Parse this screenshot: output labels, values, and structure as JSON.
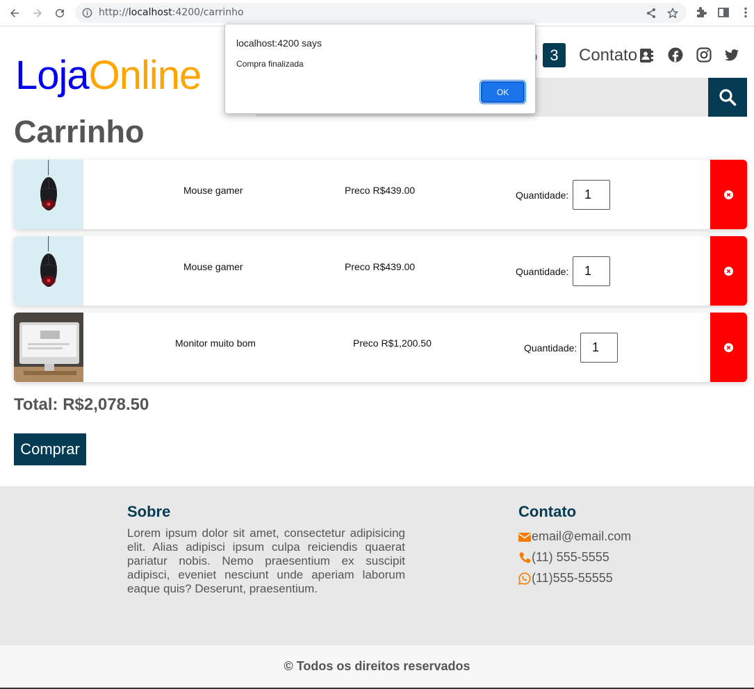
{
  "browser": {
    "url_prefix": "http://",
    "url_host": "localhost",
    "url_rest": ":4200/carrinho"
  },
  "header": {
    "logo_part1": "Loja",
    "logo_part2": "Online",
    "cart_partial": "o",
    "cart_count": "3",
    "contact_link": "Contato"
  },
  "page": {
    "title": "Carrinho",
    "items": [
      {
        "name": "Mouse gamer",
        "price": "Preco R$439.00",
        "qty_label": "Quantidade:",
        "qty": "1",
        "image": "mouse-image"
      },
      {
        "name": "Mouse gamer",
        "price": "Preco R$439.00",
        "qty_label": "Quantidade:",
        "qty": "1",
        "image": "mouse-image"
      },
      {
        "name": "Monitor muito bom",
        "price": "Preco R$1,200.50",
        "qty_label": "Quantidade:",
        "qty": "1",
        "image": "monitor-image"
      }
    ],
    "total": "Total: R$2,078.50",
    "buy_label": "Comprar"
  },
  "footer": {
    "about_title": "Sobre",
    "about_text": "Lorem ipsum dolor sit amet, consectetur adipisicing elit. Alias adipisci ipsum culpa reiciendis quaerat pariatur nobis. Nemo praesentium ex suscipit adipisci, eveniet nesciunt unde aperiam laborum eaque quis? Deserunt, praesentium.",
    "contact_title": "Contato",
    "email": "email@email.com",
    "phone": "(11) 555-5555",
    "whatsapp": "(11)555-55555",
    "copyright": "© Todos os direitos reservados"
  },
  "dialog": {
    "title": "localhost:4200 says",
    "message": "Compra finalizada",
    "ok_label": "OK"
  },
  "colors": {
    "brand_dark": "#063b54",
    "remove_red": "#ff0000",
    "logo_blue": "#0000ee",
    "logo_orange": "#ffa500",
    "contact_icon_orange": "#f57c00"
  }
}
